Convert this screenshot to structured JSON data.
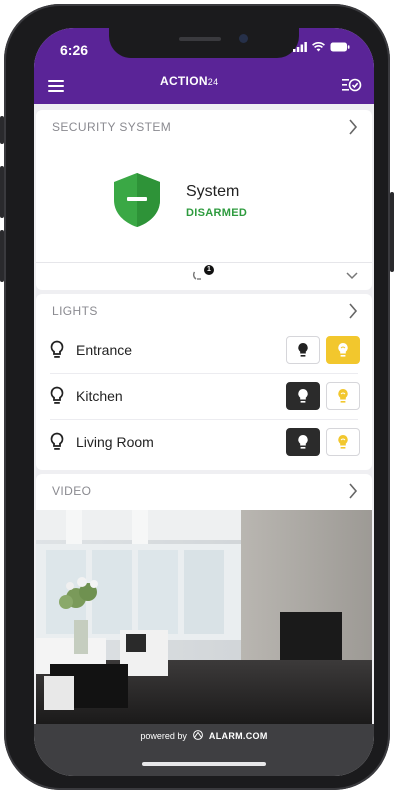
{
  "status_bar": {
    "time": "6:26"
  },
  "app_bar": {
    "brand": "ACTION",
    "brand_suffix": "24"
  },
  "security": {
    "header": "SECURITY SYSTEM",
    "system_label": "System",
    "state": "DISARMED",
    "sensor_count": "1",
    "colors": {
      "shield": "#3aa845",
      "state_text": "#2e9b3e"
    }
  },
  "lights": {
    "header": "LIGHTS",
    "items": [
      {
        "name": "Entrance",
        "on": true
      },
      {
        "name": "Kitchen",
        "on": false
      },
      {
        "name": "Living Room",
        "on": false
      }
    ],
    "colors": {
      "on": "#f2c72d",
      "off": "#2b2b2b"
    }
  },
  "video": {
    "header": "VIDEO"
  },
  "footer": {
    "powered_by": "powered by",
    "brand": "ALARM.COM"
  },
  "colors": {
    "app_bar": "#5a2497",
    "footer": "#3f3f42"
  },
  "icons": [
    "menu-icon",
    "tasks-icon",
    "chevron-right-icon",
    "shield-icon",
    "sensor-icon",
    "chevron-down-icon",
    "bulb-icon"
  ]
}
